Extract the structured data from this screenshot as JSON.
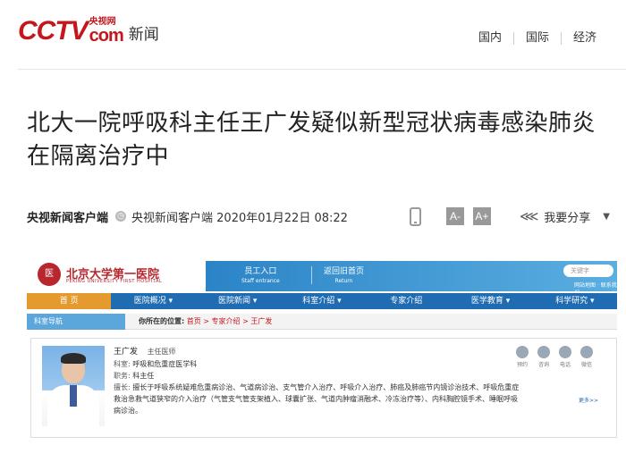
{
  "header": {
    "logo_cctv": "CCTV",
    "logo_cn": "央视网",
    "logo_com": "com",
    "logo_news": "新闻",
    "nav": [
      "国内",
      "国际",
      "经济"
    ]
  },
  "article": {
    "title": "北大一院呼吸科主任王广发疑似新型冠状病毒感染肺炎在隔离治疗中",
    "source": "央视新闻客户端",
    "info": "央视新闻客户端 2020年01月22日 08:22",
    "font_small": "A-",
    "font_large": "A+",
    "share_label": "我要分享"
  },
  "embedded": {
    "hospital_name": "北京大学第一医院",
    "hospital_name_en": "PEKING UNIVERSITY FIRST HOSPITAL",
    "staff_entrance_cn": "员工入口",
    "staff_entrance_en": "Staff entrance",
    "return_cn": "返回旧首页",
    "return_en": "Return",
    "search_placeholder": "关键字",
    "top_links": "网站地图 · 联系我们",
    "nav": [
      "首 页",
      "医院概况 ▾",
      "医院新闻 ▾",
      "科室介绍 ▾",
      "专家介绍",
      "医学教育 ▾",
      "科学研究 ▾"
    ],
    "side_label": "科室导航",
    "crumb_prefix": "你所在的位置:",
    "crumb_path": "首页 > 专家介绍 > 王广发",
    "doctor": {
      "name": "王广发",
      "rank": "主任医师",
      "dept_label": "科室:",
      "dept": "呼吸和危重症医学科",
      "title_label": "职务:",
      "title": "科主任",
      "expertise_label": "擅长:",
      "expertise": "擅长于呼吸系统疑难危重病诊治、气道病诊治、支气管介入治疗、呼吸介入治疗、肺癌及肺癌节内镜诊治技术、呼吸危重症救治急救气道狭窄的介入治疗（气管支气管支架植入、球囊扩张、气道内肿瘤消融术、冷冻治疗等）、内科胸腔镜手术、睡眠呼吸病诊治。"
    },
    "actions": [
      "预约",
      "咨询",
      "电话",
      "微信"
    ],
    "more": "更多>>"
  }
}
